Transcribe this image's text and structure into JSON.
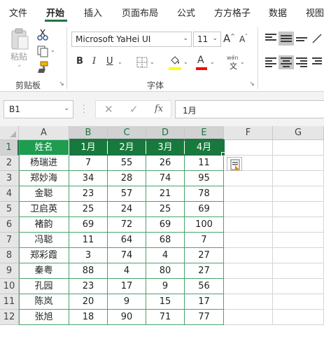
{
  "ribbon_tabs": [
    "文件",
    "开始",
    "插入",
    "页面布局",
    "公式",
    "方方格子",
    "数据",
    "视图"
  ],
  "active_tab": "开始",
  "clipboard": {
    "paste_label": "粘贴",
    "group_label": "剪贴板"
  },
  "font": {
    "name": "Microsoft YaHei UI",
    "size": "11",
    "group_label": "字体",
    "increase_label": "A",
    "decrease_label": "A",
    "bold": "B",
    "italic": "I",
    "underline": "U",
    "font_color_letter": "A",
    "phonetic_label": "wén",
    "highlight_color": "#ffff00",
    "font_color": "#ff0000"
  },
  "formula_bar": {
    "name_box": "B1",
    "formula": "1月",
    "fx_label": "fx"
  },
  "columns": [
    "A",
    "B",
    "C",
    "D",
    "E",
    "F",
    "G"
  ],
  "rows": [
    "1",
    "2",
    "3",
    "4",
    "5",
    "6",
    "7",
    "8",
    "9",
    "10",
    "11",
    "12"
  ],
  "table": {
    "header": [
      "姓名",
      "1月",
      "2月",
      "3月",
      "4月"
    ],
    "rows": [
      [
        "杨瑞进",
        "7",
        "55",
        "26",
        "11"
      ],
      [
        "郑妙海",
        "34",
        "28",
        "74",
        "95"
      ],
      [
        "金聪",
        "23",
        "57",
        "21",
        "78"
      ],
      [
        "卫启英",
        "25",
        "24",
        "25",
        "69"
      ],
      [
        "褚韵",
        "69",
        "72",
        "69",
        "100"
      ],
      [
        "冯聪",
        "11",
        "64",
        "68",
        "7"
      ],
      [
        "郑彩霞",
        "3",
        "74",
        "4",
        "27"
      ],
      [
        "秦粤",
        "88",
        "4",
        "80",
        "27"
      ],
      [
        "孔园",
        "23",
        "17",
        "9",
        "56"
      ],
      [
        "陈岚",
        "20",
        "9",
        "15",
        "17"
      ],
      [
        "张旭",
        "18",
        "90",
        "71",
        "77"
      ]
    ]
  },
  "colors": {
    "accent": "#217346",
    "table_header_bg": "#1e9c4f",
    "table_header_selected_bg": "#177a3c",
    "table_border": "#4aa36c"
  }
}
